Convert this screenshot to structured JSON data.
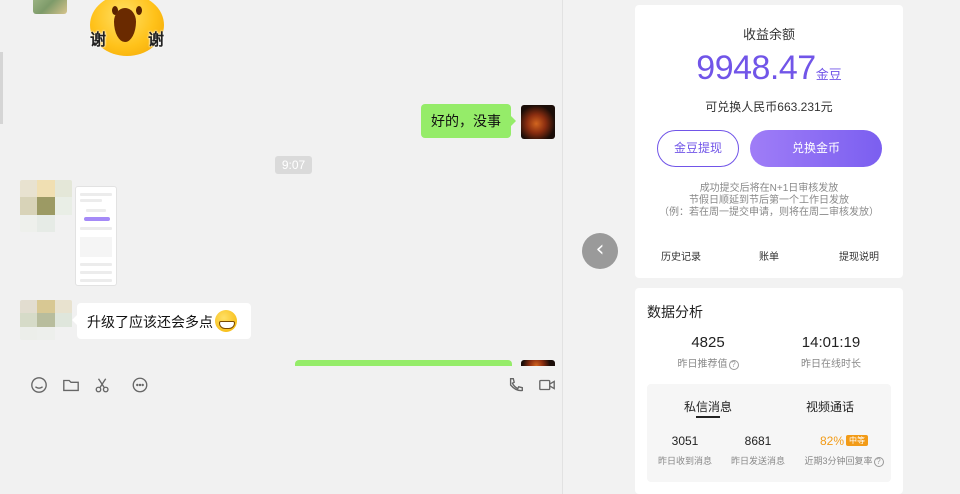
{
  "chat": {
    "sticker_text_left": "谢",
    "sticker_text_right": "谢",
    "msg_mine_1": "好的，没事",
    "time_divider": "9:07",
    "msg_theirs_1": "升级了应该还会多点",
    "msg_theirs_1_emoji": "grin-emoji",
    "toolbar_icons": [
      "emoji-icon",
      "folder-icon",
      "scissors-icon",
      "chat-bubble-icon",
      "phone-icon",
      "video-icon"
    ]
  },
  "earnings": {
    "title": "收益余额",
    "balance": "9948.47",
    "unit": "金豆",
    "rmb_text": "可兑换人民币663.231元",
    "withdraw_label": "金豆提现",
    "exchange_label": "兑换金币",
    "note_1": "成功提交后将在N+1日审核发放",
    "note_2": "节假日顺延到节后第一个工作日发放",
    "note_3": "（例：若在周一提交申请，则将在周二审核发放）",
    "link_history": "历史记录",
    "link_bill": "账单",
    "link_help": "提现说明",
    "accent_color": "#7155e8"
  },
  "stats": {
    "title": "数据分析",
    "recommend_value": "4825",
    "recommend_label": "昨日推荐值",
    "online_value": "14:01:19",
    "online_label": "昨日在线时长",
    "tab_messages": "私信消息",
    "tab_video": "视频通话",
    "received_value": "3051",
    "received_label": "昨日收到消息",
    "sent_value": "8681",
    "sent_label": "昨日发送消息",
    "reply_rate_value": "82%",
    "reply_rate_badge": "中等",
    "reply_rate_label": "近期3分钟回复率",
    "help_mark": "?"
  },
  "nav": {
    "back_glyph": "‹"
  }
}
